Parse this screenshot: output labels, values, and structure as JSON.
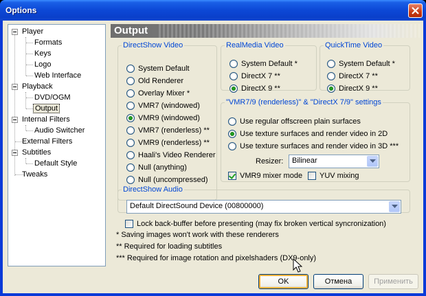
{
  "window": {
    "title": "Options"
  },
  "tree": {
    "items": [
      {
        "label": "Player"
      },
      {
        "label": "Formats"
      },
      {
        "label": "Keys"
      },
      {
        "label": "Logo"
      },
      {
        "label": "Web Interface"
      },
      {
        "label": "Playback"
      },
      {
        "label": "DVD/OGM"
      },
      {
        "label": "Output"
      },
      {
        "label": "Internal Filters"
      },
      {
        "label": "Audio Switcher"
      },
      {
        "label": "External Filters"
      },
      {
        "label": "Subtitles"
      },
      {
        "label": "Default Style"
      },
      {
        "label": "Tweaks"
      }
    ],
    "selected": "Output"
  },
  "panel": {
    "title": "Output"
  },
  "directshow_video": {
    "legend": "DirectShow Video",
    "options": [
      {
        "label": "System Default",
        "checked": false
      },
      {
        "label": "Old Renderer",
        "checked": false
      },
      {
        "label": "Overlay Mixer *",
        "checked": false
      },
      {
        "label": "VMR7 (windowed)",
        "checked": false
      },
      {
        "label": "VMR9 (windowed)",
        "checked": true
      },
      {
        "label": "VMR7 (renderless) **",
        "checked": false
      },
      {
        "label": "VMR9 (renderless) **",
        "checked": false
      },
      {
        "label": "Haali's Video Renderer",
        "checked": false
      },
      {
        "label": "Null (anything)",
        "checked": false
      },
      {
        "label": "Null (uncompressed)",
        "checked": false
      }
    ]
  },
  "realmedia_video": {
    "legend": "RealMedia Video",
    "options": [
      {
        "label": "System Default *",
        "checked": false
      },
      {
        "label": "DirectX 7 **",
        "checked": false
      },
      {
        "label": "DirectX 9 **",
        "checked": true
      }
    ]
  },
  "quicktime_video": {
    "legend": "QuickTime Video",
    "options": [
      {
        "label": "System Default *",
        "checked": false
      },
      {
        "label": "DirectX 7 **",
        "checked": false
      },
      {
        "label": "DirectX 9 **",
        "checked": true
      }
    ]
  },
  "renderless_settings": {
    "legend": "\"VMR7/9 (renderless)\" & \"DirectX 7/9\" settings",
    "options": [
      {
        "label": "Use regular offscreen plain surfaces",
        "checked": false
      },
      {
        "label": "Use texture surfaces and render video in 2D",
        "checked": true
      },
      {
        "label": "Use texture surfaces and render video in 3D ***",
        "checked": false
      }
    ],
    "resizer_label": "Resizer:",
    "resizer_value": "Bilinear",
    "vmr9_mixer_label": "VMR9 mixer mode",
    "vmr9_mixer_checked": true,
    "yuv_mixing_label": "YUV mixing",
    "yuv_mixing_checked": false
  },
  "directshow_audio": {
    "legend": "DirectShow Audio",
    "device": "Default DirectSound Device (00800000)"
  },
  "lock_backbuffer": {
    "label": "Lock back-buffer before presenting (may fix broken vertical syncronization)",
    "checked": false
  },
  "notes": [
    "* Saving images won't work with these renderers",
    "** Required for loading subtitles",
    "*** Required for image rotation and pixelshaders (DX9-only)"
  ],
  "buttons": {
    "ok": "OK",
    "cancel": "Отмена",
    "apply": "Применить"
  },
  "colors": {
    "title_bar": "#0c48d6",
    "legend": "#0046d5",
    "dialog_bg": "#ece9d8"
  }
}
